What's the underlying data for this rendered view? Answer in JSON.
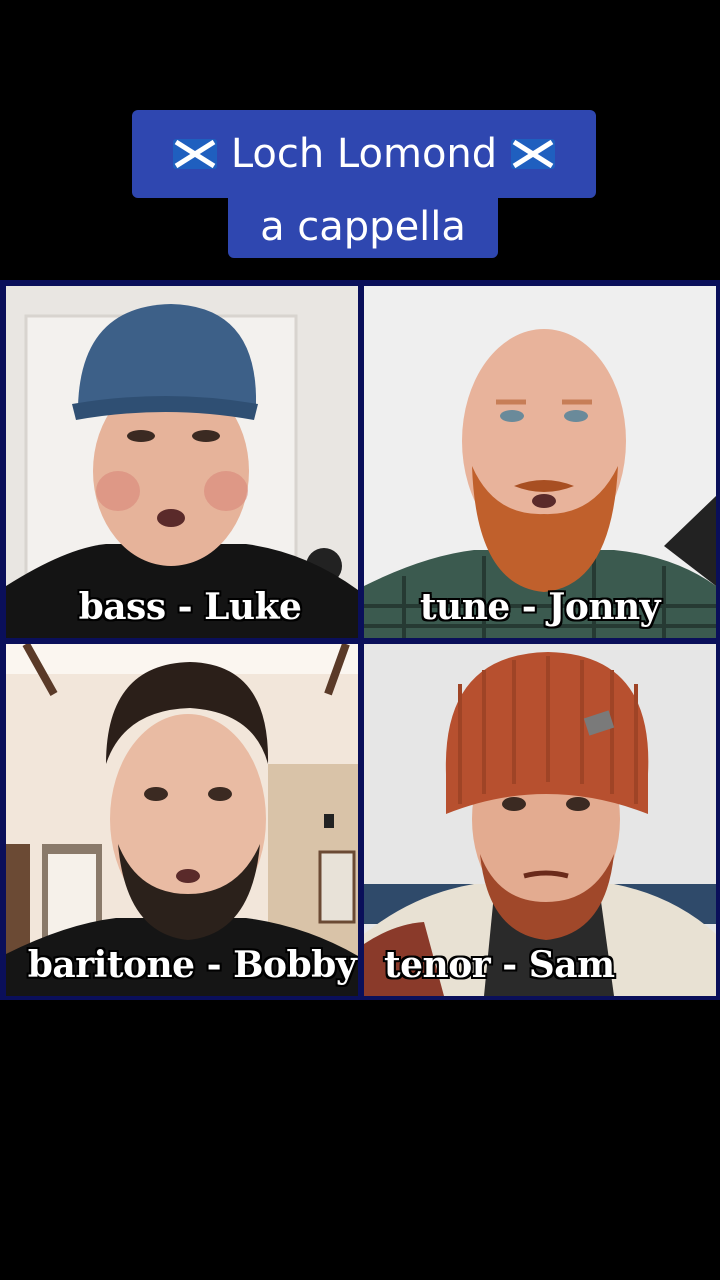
{
  "title": {
    "line1": "Loch Lomond",
    "line2": "a cappella",
    "flag_icon": "scottish-saltire-flag",
    "caption_color": "#2f47b0"
  },
  "grid": {
    "border_color": "#0a0f5a",
    "tiles": [
      {
        "label": "bass - Luke"
      },
      {
        "label": "tune - Jonny"
      },
      {
        "label": "baritone - Bobby"
      },
      {
        "label": "tenor - Sam"
      }
    ]
  }
}
